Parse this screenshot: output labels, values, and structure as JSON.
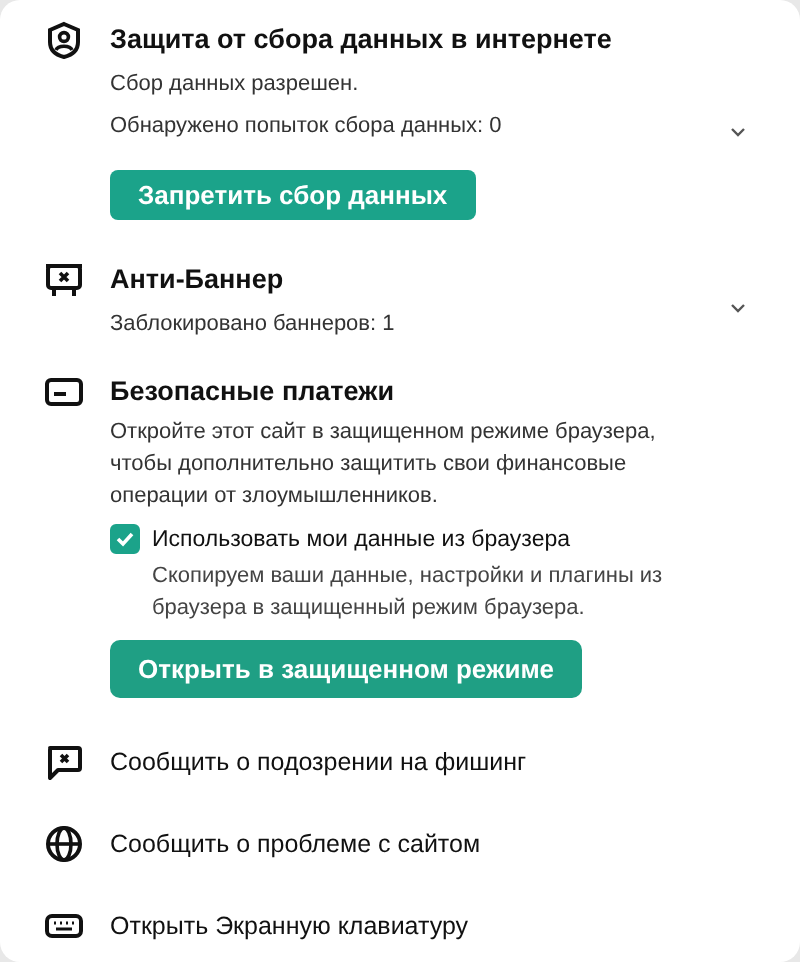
{
  "sections": [
    {
      "kind": "tracking",
      "title": "Защита от сбора данных в интернете",
      "lines": [
        "Сбор данных разрешен.",
        "Обнаружено попыток сбора данных: 0"
      ],
      "button": "Запретить сбор данных",
      "expanded": false
    },
    {
      "kind": "banner",
      "title": "Анти-Баннер",
      "lines": [
        "Заблокировано баннеров: 1"
      ],
      "expanded": false
    },
    {
      "kind": "payments",
      "title": "Безопасные платежи",
      "description": "Откройте этот сайт в защищенном режиме браузера, чтобы дополнительно защитить свои финансовые операции от злоумышленников.",
      "option": {
        "label": "Использовать мои данные из браузера",
        "checked": true,
        "hint": "Скопируем ваши данные, настройки и плагины из браузера в защищенный режим браузера."
      },
      "button": "Открыть в защищенном режиме"
    }
  ],
  "actions": [
    {
      "kind": "phishing",
      "label": "Сообщить о подозрении на фишинг"
    },
    {
      "kind": "site",
      "label": "Сообщить о проблеме с сайтом"
    },
    {
      "kind": "keyboard",
      "label": "Открыть Экранную клавиатуру"
    }
  ]
}
